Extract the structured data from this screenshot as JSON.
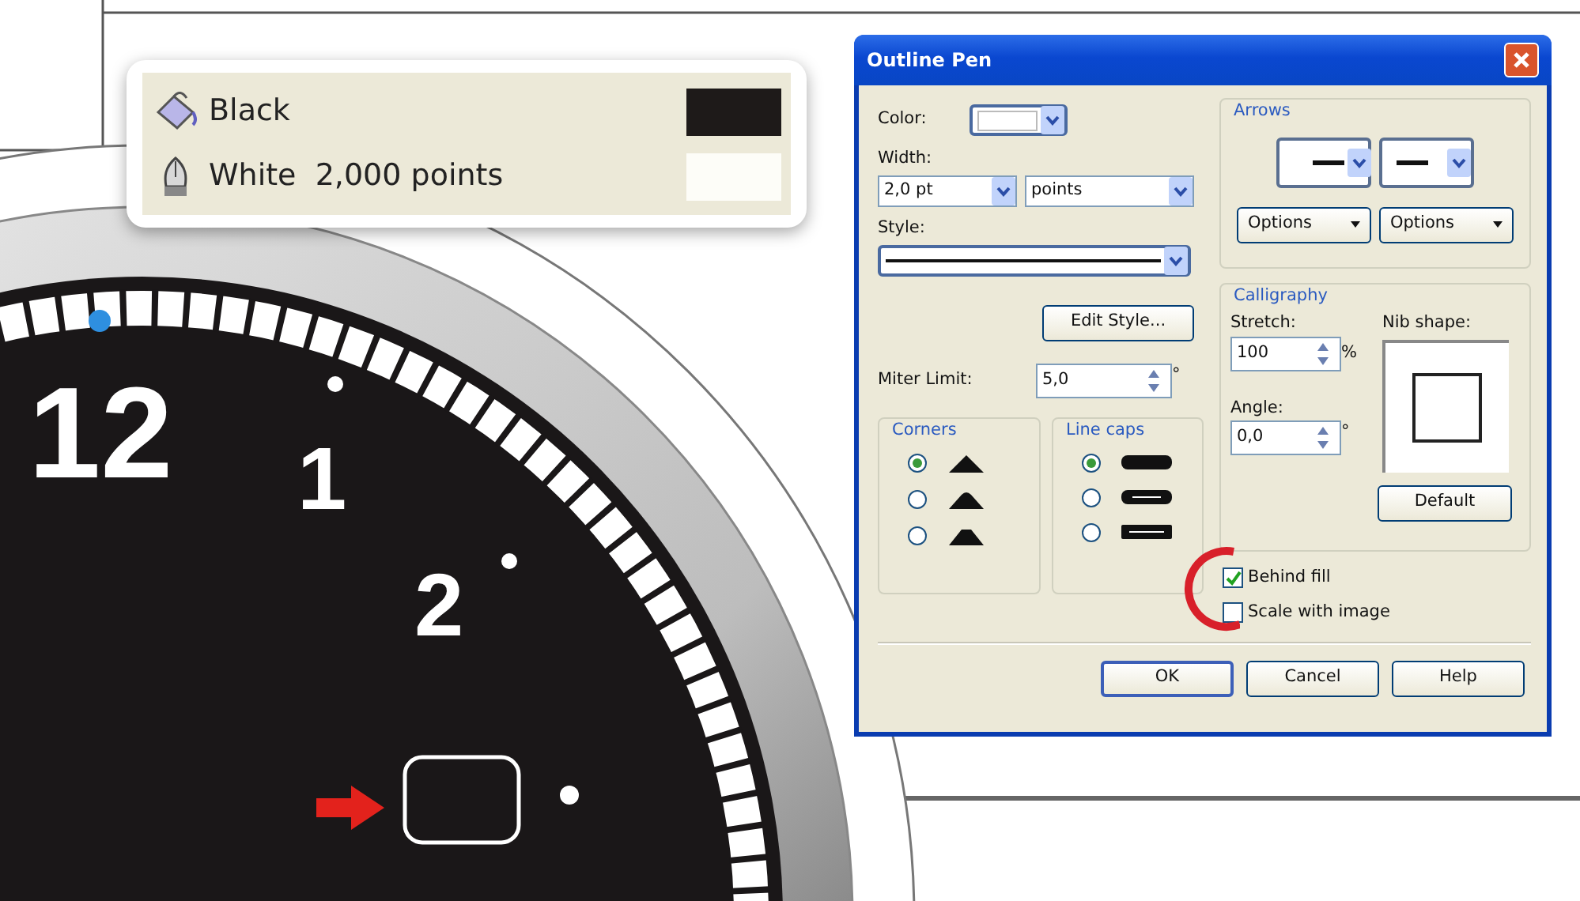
{
  "canvas": {
    "dial_numerals": [
      "12",
      "1",
      "2"
    ]
  },
  "status_popup": {
    "rows": [
      {
        "kind": "fill",
        "label": "Black",
        "color": "#1e1a19"
      },
      {
        "kind": "outline",
        "label": "White  2,000 points",
        "color": "#fdfdf8"
      }
    ]
  },
  "dialog": {
    "title": "Outline Pen",
    "color": {
      "label": "Color:"
    },
    "width": {
      "label": "Width:",
      "value": "2,0 pt",
      "unit": "points"
    },
    "style": {
      "label": "Style:"
    },
    "edit_style_button": "Edit Style...",
    "miter_limit": {
      "label": "Miter Limit:",
      "value": "5,0",
      "unit": "°"
    },
    "corners": {
      "title": "Corners",
      "options": [
        {
          "selected": true
        },
        {
          "selected": false
        },
        {
          "selected": false
        }
      ]
    },
    "line_caps": {
      "title": "Line caps",
      "options": [
        {
          "selected": true
        },
        {
          "selected": false
        },
        {
          "selected": false
        }
      ]
    },
    "arrows": {
      "title": "Arrows",
      "options_buttons": [
        "Options",
        "Options"
      ]
    },
    "calligraphy": {
      "title": "Calligraphy",
      "stretch": {
        "label": "Stretch:",
        "value": "100",
        "unit": "%"
      },
      "angle": {
        "label": "Angle:",
        "value": "0,0",
        "unit": "°"
      },
      "nib_shape": {
        "label": "Nib shape:"
      },
      "default_button": "Default"
    },
    "checkboxes": [
      {
        "label": "Behind fill",
        "checked": true
      },
      {
        "label": "Scale with image",
        "checked": false
      }
    ],
    "buttons": [
      "OK",
      "Cancel",
      "Help"
    ]
  }
}
